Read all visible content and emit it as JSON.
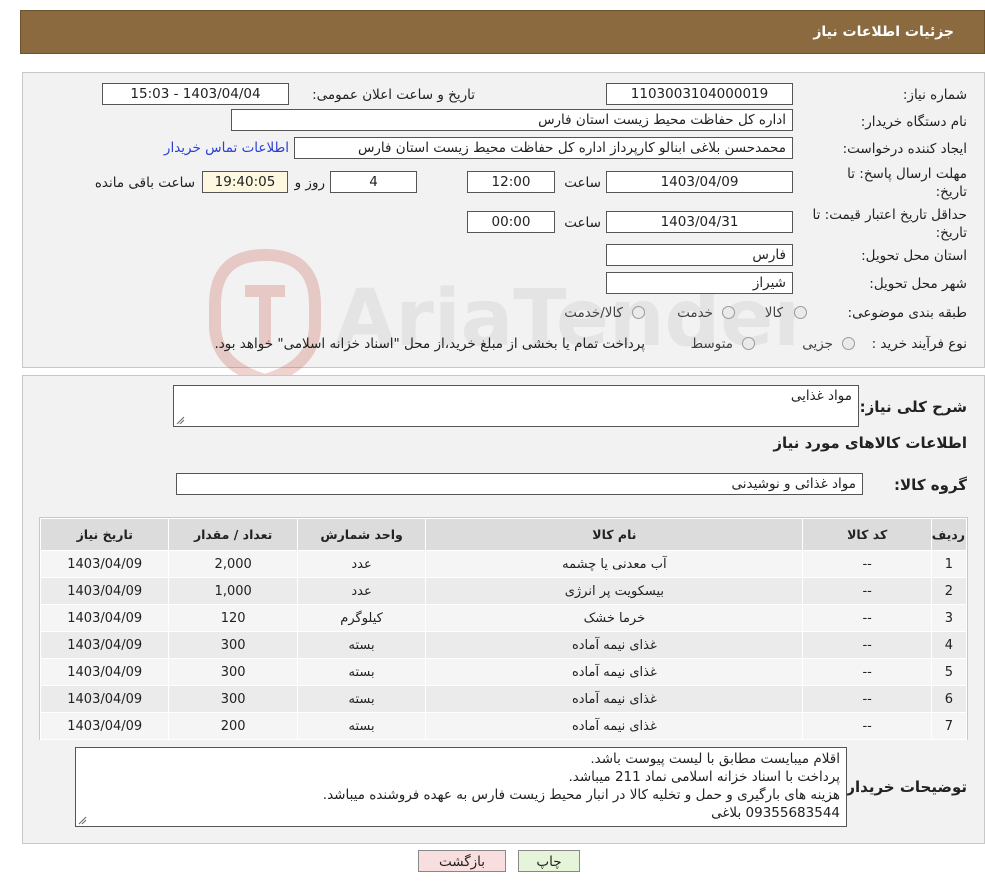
{
  "header": {
    "title": "جزئیات اطلاعات نیاز"
  },
  "info": {
    "need_number_label": "شماره نیاز:",
    "need_number": "1103003104000019",
    "announce_label": "تاریخ و ساعت اعلان عمومی:",
    "announce_value": "1403/04/04 - 15:03",
    "buyer_label": "نام دستگاه خریدار:",
    "buyer_value": "اداره کل حفاظت محیط زیست استان فارس",
    "creator_label": "ایجاد کننده درخواست:",
    "creator_value": "محمدحسن بلاغی ابنالو کارپرداز اداره کل حفاظت محیط زیست استان فارس",
    "contact_link": "اطلاعات تماس خریدار",
    "deadline_label_1": "مهلت ارسال پاسخ: تا",
    "deadline_label_2": "تاریخ:",
    "deadline_date": "1403/04/09",
    "time_label": "ساعت",
    "deadline_time": "12:00",
    "days_value": "4",
    "days_label": "روز و",
    "remaining_time": "19:40:05",
    "remaining_label": "ساعت باقی مانده",
    "validity_label_1": "حداقل تاریخ اعتبار قیمت: تا",
    "validity_label_2": "تاریخ:",
    "validity_date": "1403/04/31",
    "validity_time_label": "ساعت",
    "validity_time": "00:00",
    "province_label": "استان محل تحویل:",
    "province_value": "فارس",
    "city_label": "شهر محل تحویل:",
    "city_value": "شیراز",
    "category_label": "طبقه بندی موضوعی:",
    "category_options": [
      "کالا",
      "خدمت",
      "کالا/خدمت"
    ],
    "process_label": "نوع فرآیند خرید :",
    "process_options": [
      "جزیی",
      "متوسط"
    ],
    "process_note": "پرداخت تمام یا بخشی از مبلغ خرید،از محل \"اسناد خزانه اسلامی\" خواهد بود."
  },
  "summary": {
    "label": "شرح کلی نیاز:",
    "value": "مواد غذایی",
    "items_heading": "اطلاعات کالاهای مورد نیاز",
    "group_label": "گروه کالا:",
    "group_value": "مواد غذائی و نوشیدنی"
  },
  "table": {
    "headers": [
      "ردیف",
      "کد کالا",
      "نام کالا",
      "واحد شمارش",
      "تعداد / مقدار",
      "تاریخ نیاز"
    ],
    "rows": [
      [
        "1",
        "--",
        "آب معدنی یا چشمه",
        "عدد",
        "2,000",
        "1403/04/09"
      ],
      [
        "2",
        "--",
        "بیسکویت پر انرژی",
        "عدد",
        "1,000",
        "1403/04/09"
      ],
      [
        "3",
        "--",
        "خرما خشک",
        "کیلوگرم",
        "120",
        "1403/04/09"
      ],
      [
        "4",
        "--",
        "غذای نیمه آماده",
        "بسته",
        "300",
        "1403/04/09"
      ],
      [
        "5",
        "--",
        "غذای نیمه آماده",
        "بسته",
        "300",
        "1403/04/09"
      ],
      [
        "6",
        "--",
        "غذای نیمه آماده",
        "بسته",
        "300",
        "1403/04/09"
      ],
      [
        "7",
        "--",
        "غذای نیمه آماده",
        "بسته",
        "200",
        "1403/04/09"
      ]
    ]
  },
  "notes": {
    "label": "توضیحات خریدار:",
    "lines": [
      "اقلام میبایست مطابق با لیست پیوست باشد.",
      "پرداخت با اسناد خزانه اسلامی نماد 211 میباشد.",
      "هزینه های بارگیری و حمل و تخلیه کالا در انبار محیط زیست فارس به عهده فروشنده میباشد.",
      "09355683544 بلاغی"
    ]
  },
  "buttons": {
    "print": "چاپ",
    "back": "بازگشت"
  },
  "watermark": {
    "text": "AriaTender.neT"
  }
}
